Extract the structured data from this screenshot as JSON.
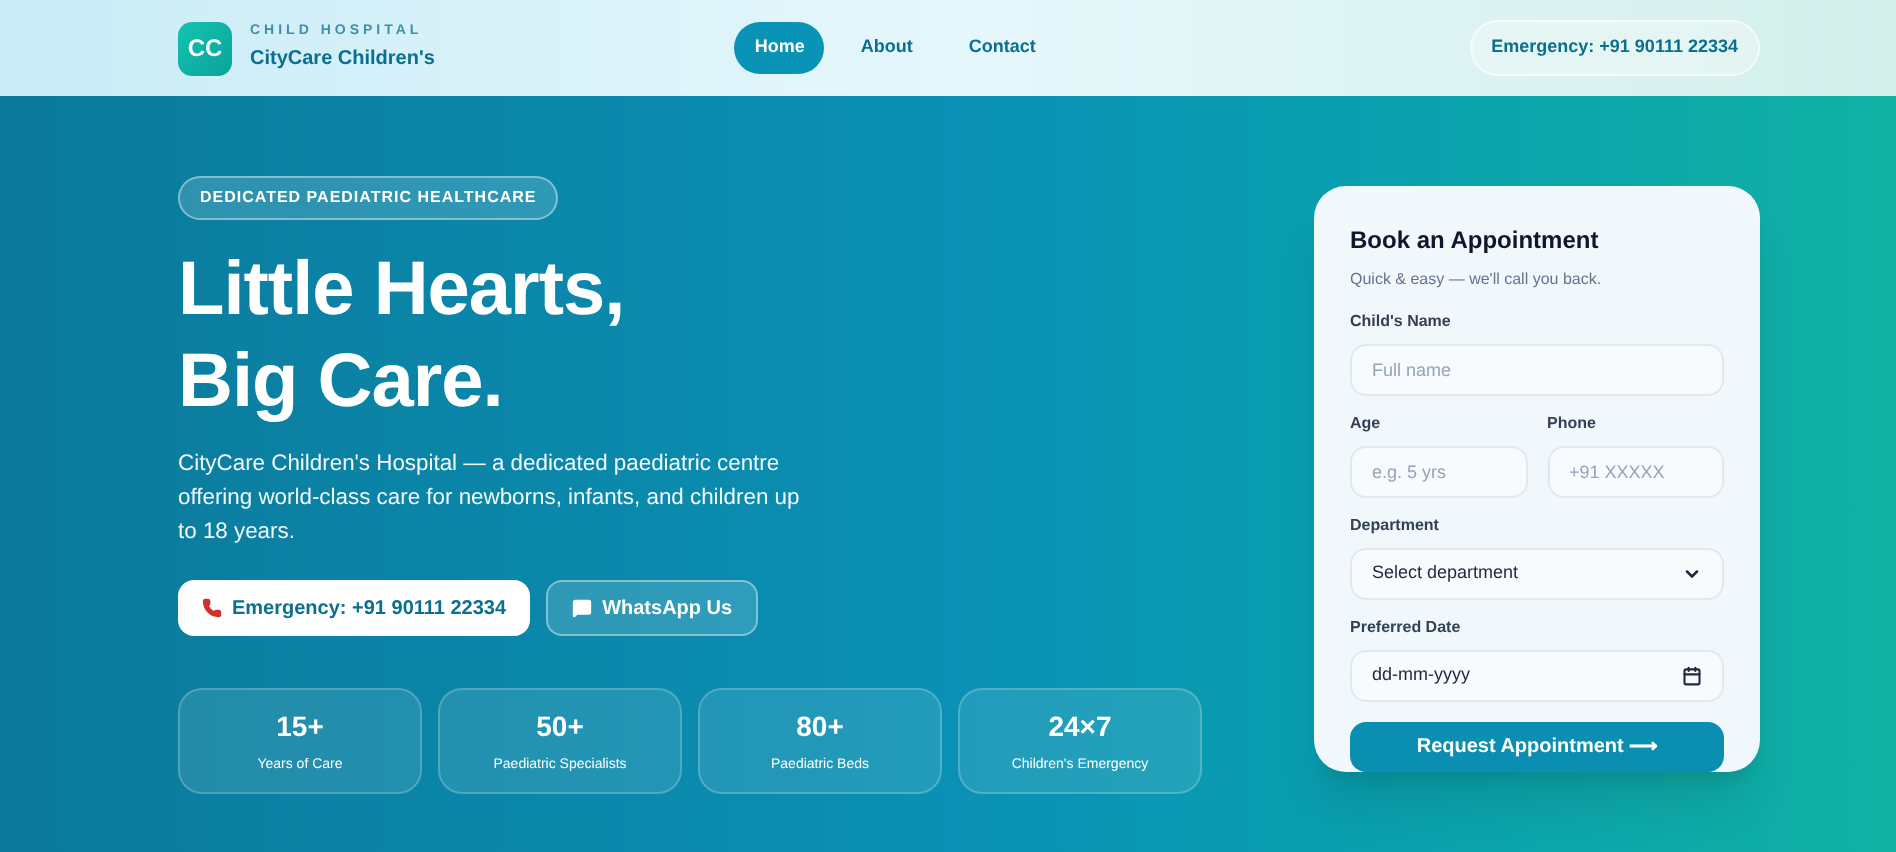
{
  "header": {
    "logo": "CC",
    "tagline": "CHILD HOSPITAL",
    "brand": "CityCare Children's",
    "nav": [
      {
        "label": "Home",
        "selected": true
      },
      {
        "label": "About",
        "selected": false
      },
      {
        "label": "Contact",
        "selected": false
      }
    ],
    "emergency": "Emergency: +91 90111 22334"
  },
  "hero": {
    "badge": "DEDICATED PAEDIATRIC HEALTHCARE",
    "title_lines": [
      "Little Hearts,",
      "Big Care."
    ],
    "description": "CityCare Children's Hospital — a dedicated paediatric centre offering world-class care for newborns, infants, and children up to 18 years.",
    "buttons": [
      {
        "kind": "phone",
        "label": "Emergency: +91 90111 22334"
      },
      {
        "kind": "chat",
        "label": "WhatsApp Us"
      }
    ],
    "stats": [
      {
        "value": "15+",
        "label": "Years of Care"
      },
      {
        "value": "50+",
        "label": "Paediatric Specialists"
      },
      {
        "value": "80+",
        "label": "Paediatric Beds"
      },
      {
        "value": "24×7",
        "label": "Children's Emergency"
      }
    ]
  },
  "form": {
    "title": "Book an Appointment",
    "subtitle": "Quick & easy — we'll call you back.",
    "rows": [
      [
        {
          "kind": "text",
          "label": "Child's Name",
          "placeholder": "Full name"
        }
      ],
      [
        {
          "kind": "text",
          "label": "Age",
          "placeholder": "e.g. 5 yrs"
        },
        {
          "kind": "text",
          "label": "Phone",
          "placeholder": "+91 XXXXX"
        }
      ],
      [
        {
          "kind": "select",
          "label": "Department",
          "value": "Select department"
        }
      ],
      [
        {
          "kind": "date",
          "label": "Preferred Date",
          "value": "dd-mm-yyyy"
        }
      ]
    ],
    "submit": "Request Appointment ⟶"
  }
}
